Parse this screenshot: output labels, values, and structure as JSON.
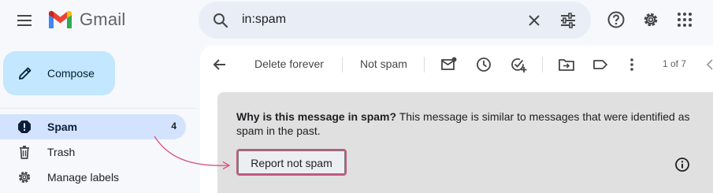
{
  "header": {
    "app_name": "Gmail",
    "search": {
      "query": "in:spam"
    },
    "icons": [
      "menu-icon",
      "gmail-logo",
      "search-icon",
      "clear-icon",
      "search-options-icon",
      "help-icon",
      "settings-icon",
      "apps-icon"
    ]
  },
  "sidebar": {
    "compose_label": "Compose",
    "items": [
      {
        "label": "Spam",
        "count": "4",
        "icon": "spam-icon",
        "selected": true
      },
      {
        "label": "Trash",
        "icon": "trash-icon"
      },
      {
        "label": "Manage labels",
        "icon": "gear-icon"
      }
    ]
  },
  "toolbar": {
    "delete_forever_label": "Delete forever",
    "not_spam_label": "Not spam",
    "icons": [
      "back-icon",
      "mark-unread-icon",
      "snooze-icon",
      "add-task-icon",
      "move-to-icon",
      "label-icon",
      "more-icon",
      "chevron-left-icon"
    ],
    "pagination": "1 of 7"
  },
  "spam_banner": {
    "question": "Why is this message in spam?",
    "explanation": " This message is similar to messages that were identified as spam in the past.",
    "button_label": "Report not spam",
    "icons": [
      "info-icon"
    ]
  },
  "colors": {
    "compose_bg": "#c2e7ff",
    "selected_nav_bg": "#d3e3fd",
    "banner_bg": "#e0e0e0",
    "annotation_arrow": "#d6557f"
  }
}
